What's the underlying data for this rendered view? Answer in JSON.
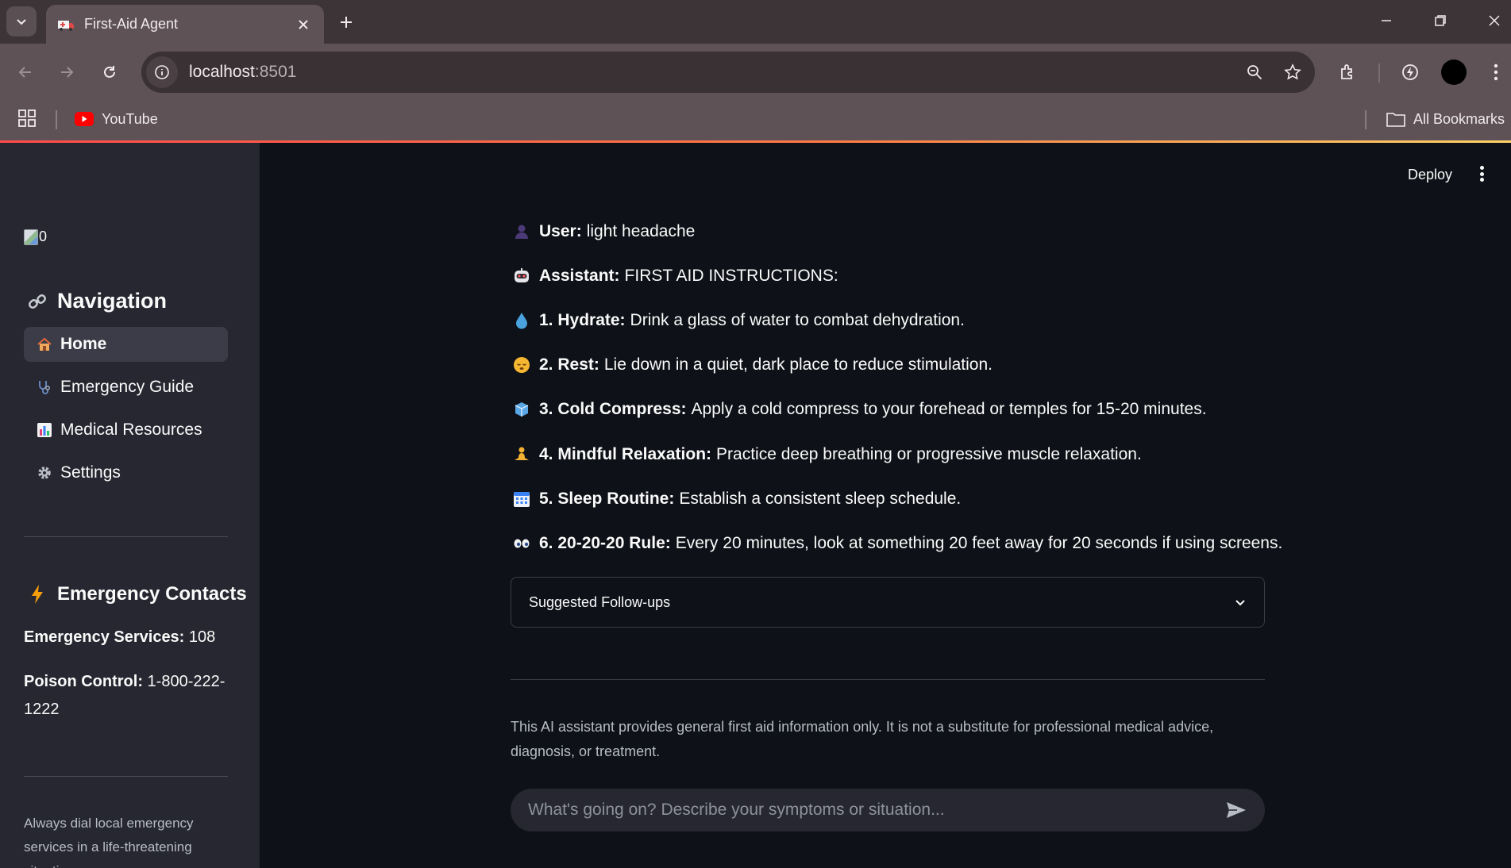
{
  "browser": {
    "tab_title": "First-Aid Agent",
    "url_host": "localhost",
    "url_port": ":8501",
    "bookmarks": [
      {
        "label": "YouTube"
      },
      {
        "label": "All Bookmarks"
      }
    ]
  },
  "app": {
    "deploy_label": "Deploy",
    "logo_alt": "0"
  },
  "sidebar": {
    "navigation_heading": "Navigation",
    "nav_items": [
      {
        "label": "Home",
        "icon": "house-icon",
        "active": true
      },
      {
        "label": "Emergency Guide",
        "icon": "stethoscope-icon",
        "active": false
      },
      {
        "label": "Medical Resources",
        "icon": "bar-chart-icon",
        "active": false
      },
      {
        "label": "Settings",
        "icon": "gear-icon",
        "active": false
      }
    ],
    "emergency_heading": "Emergency Contacts",
    "contacts": [
      {
        "label": "Emergency Services:",
        "value": "108"
      },
      {
        "label": "Poison Control:",
        "value": "1-800-222-1222"
      }
    ],
    "footnote": "Always dial local emergency services in a life-threatening situation."
  },
  "chat": {
    "messages": [
      {
        "icon": "user-icon",
        "label": "User:",
        "text": "light headache"
      },
      {
        "icon": "robot-icon",
        "label": "Assistant:",
        "text": "FIRST AID INSTRUCTIONS:"
      },
      {
        "icon": "droplet-icon",
        "label": "1. Hydrate:",
        "text": "Drink a glass of water to combat dehydration."
      },
      {
        "icon": "sleeping-face-icon",
        "label": "2. Rest:",
        "text": "Lie down in a quiet, dark place to reduce stimulation."
      },
      {
        "icon": "ice-cube-icon",
        "label": "3. Cold Compress:",
        "text": "Apply a cold compress to your forehead or temples for 15-20 minutes."
      },
      {
        "icon": "meditation-icon",
        "label": "4. Mindful Relaxation:",
        "text": "Practice deep breathing or progressive muscle relaxation."
      },
      {
        "icon": "calendar-icon",
        "label": "5. Sleep Routine:",
        "text": "Establish a consistent sleep schedule."
      },
      {
        "icon": "eyes-icon",
        "label": "6. 20-20-20 Rule:",
        "text": "Every 20 minutes, look at something 20 feet away for 20 seconds if using screens."
      }
    ],
    "followups_label": "Suggested Follow-ups",
    "disclaimer": "This AI assistant provides general first aid information only. It is not a substitute for professional medical advice, diagnosis, or treatment.",
    "input_placeholder": "What's going on? Describe your symptoms or situation..."
  }
}
